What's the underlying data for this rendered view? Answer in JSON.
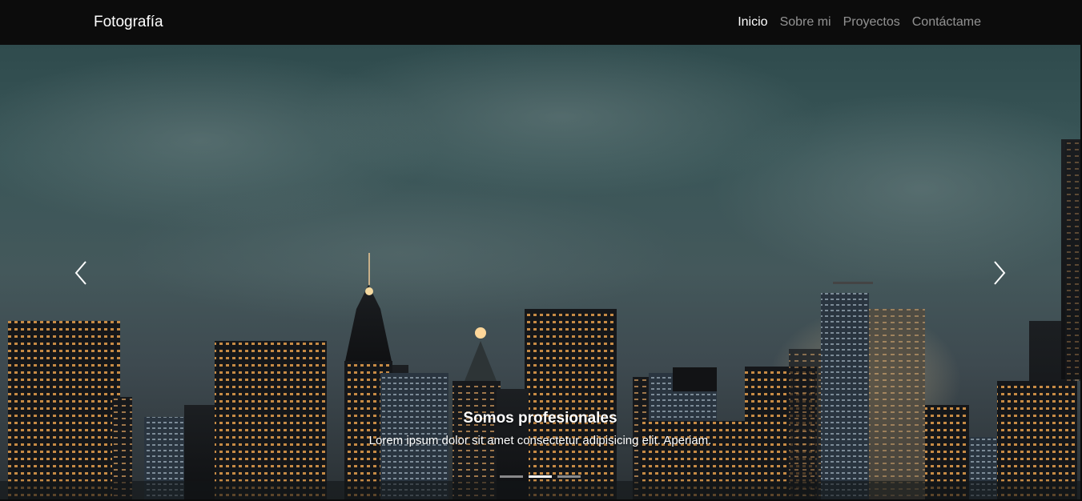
{
  "navbar": {
    "brand": "Fotografía",
    "links": [
      {
        "label": "Inicio",
        "active": true
      },
      {
        "label": "Sobre mi",
        "active": false
      },
      {
        "label": "Proyectos",
        "active": false
      },
      {
        "label": "Contáctame",
        "active": false
      }
    ]
  },
  "carousel": {
    "slide_description": "night city skyline under cloudy sky",
    "caption_title": "Somos profesionales",
    "caption_text": "Lorem ipsum dolor sit amet consectetur adipisicing elit. Aperiam.",
    "prev_icon": "chevron-left-icon",
    "next_icon": "chevron-right-icon",
    "indicators": [
      {
        "active": false
      },
      {
        "active": true
      },
      {
        "active": false
      }
    ]
  },
  "colors": {
    "navbar_bg": "#0c0c0c",
    "link_active": "#ffffff",
    "link_inactive": "rgba(255,255,255,0.55)"
  }
}
